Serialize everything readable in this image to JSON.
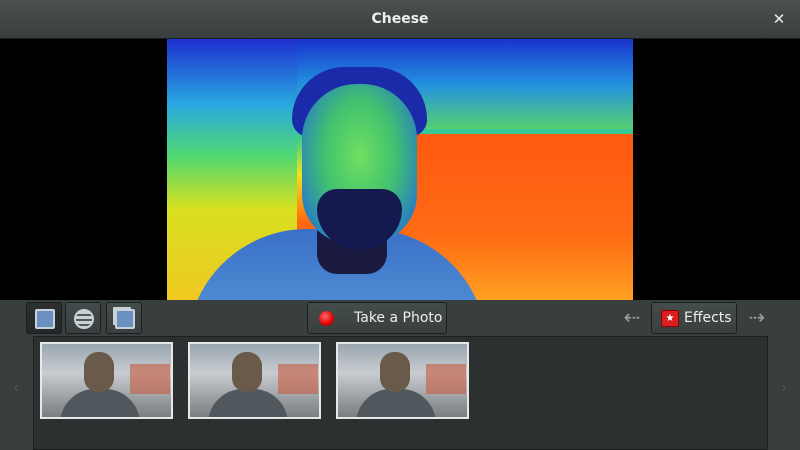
{
  "window": {
    "title": "Cheese",
    "close_glyph": "✕"
  },
  "toolbar": {
    "modes": [
      {
        "name": "photo-mode",
        "icon": "photo-mode-icon",
        "selected": true
      },
      {
        "name": "video-mode",
        "icon": "video-mode-icon",
        "selected": false
      },
      {
        "name": "burst-mode",
        "icon": "burst-mode-icon",
        "selected": false
      }
    ],
    "take_photo_label": "Take a Photo",
    "effects_label": "Effects",
    "prev_arrow": "⇠",
    "next_arrow": "⇢"
  },
  "thumbnails": {
    "prev_glyph": "‹",
    "next_glyph": "›",
    "count": 3
  },
  "colors": {
    "record_button": "#e00000",
    "effects_icon": "#d81e1e",
    "background": "#393f3f"
  }
}
